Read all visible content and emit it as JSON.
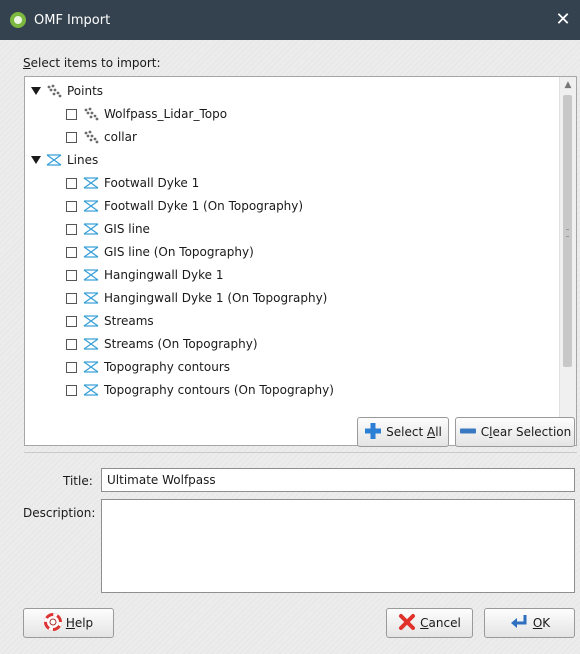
{
  "window": {
    "title": "OMF Import",
    "close_glyph": "✕"
  },
  "tree": {
    "label_prefix": "S",
    "label_rest": "elect items to import:",
    "nodes": [
      {
        "label": "Points",
        "type": "group",
        "icon": "points-icon"
      },
      {
        "label": "Wolfpass_Lidar_Topo",
        "type": "item",
        "icon": "points-icon",
        "checked": false
      },
      {
        "label": "collar",
        "type": "item",
        "icon": "points-icon",
        "checked": false
      },
      {
        "label": "Lines",
        "type": "group",
        "icon": "lines-icon"
      },
      {
        "label": "Footwall Dyke 1",
        "type": "item",
        "icon": "lines-icon",
        "checked": false
      },
      {
        "label": "Footwall Dyke 1 (On Topography)",
        "type": "item",
        "icon": "lines-icon",
        "checked": false
      },
      {
        "label": "GIS line",
        "type": "item",
        "icon": "lines-icon",
        "checked": false
      },
      {
        "label": "GIS line (On Topography)",
        "type": "item",
        "icon": "lines-icon",
        "checked": false
      },
      {
        "label": "Hangingwall Dyke 1",
        "type": "item",
        "icon": "lines-icon",
        "checked": false
      },
      {
        "label": "Hangingwall Dyke 1 (On Topography)",
        "type": "item",
        "icon": "lines-icon",
        "checked": false
      },
      {
        "label": "Streams",
        "type": "item",
        "icon": "lines-icon",
        "checked": false
      },
      {
        "label": "Streams (On Topography)",
        "type": "item",
        "icon": "lines-icon",
        "checked": false
      },
      {
        "label": "Topography contours",
        "type": "item",
        "icon": "lines-icon",
        "checked": false
      },
      {
        "label": "Topography contours (On Topography)",
        "type": "item",
        "icon": "lines-icon",
        "checked": false
      }
    ]
  },
  "buttons": {
    "select_all_pre": "Select ",
    "select_all_u": "A",
    "select_all_post": "ll",
    "clear_pre": "C",
    "clear_u": "l",
    "clear_post": "ear Selection",
    "help_u": "H",
    "help_post": "elp",
    "cancel_u": "C",
    "cancel_post": "ancel",
    "ok_pre": "",
    "ok_u": "O",
    "ok_post": "K"
  },
  "form": {
    "title_label": "Title:",
    "title_value": "Ultimate Wolfpass",
    "description_label": "Description:",
    "description_value": ""
  },
  "colors": {
    "titlebar": "#33424e",
    "app_icon": "#7cb83f",
    "lines_icon": "#3aa0d8",
    "points_icon": "#6b6b6b",
    "plus_icon": "#2b7fd4",
    "minus_icon": "#3a78c2"
  }
}
